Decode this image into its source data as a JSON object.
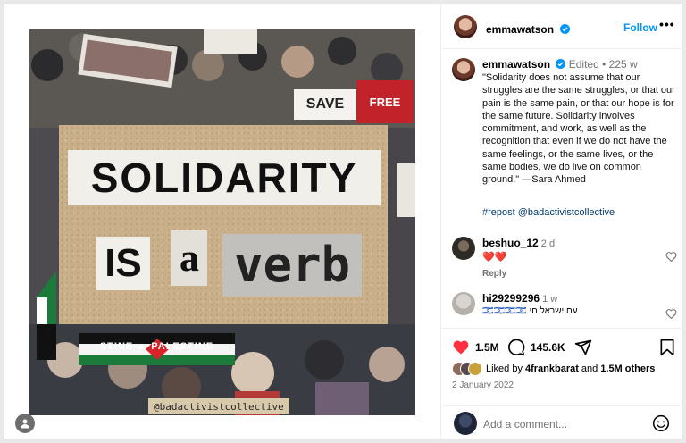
{
  "post": {
    "author": "emmawatson",
    "follow_label": "Follow",
    "more_label": "•••",
    "caption_meta_edited": "Edited",
    "caption_meta_dot": "•",
    "caption_meta_age": "225 w",
    "caption_text": "\"Solidarity does not assume that our struggles are the same struggles, or that our pain is the same pain, or that our hope is for the same future. Solidarity involves commitment, and work, as well as the recognition that even if we do not have the same feelings, or the same lives, or the same bodies, we do live on common ground.\" —Sara Ahmed",
    "caption_tags": "#repost @badactivistcollective"
  },
  "image": {
    "headline_word_1": "SOLIDARITY",
    "headline_word_2": "IS",
    "headline_word_3": "a",
    "headline_word_4": "verb",
    "sign_save": "SAVE",
    "sign_free": "FREE",
    "banner_text": "STINE ▲ PALESTINE",
    "watermark": "@badactivistcollective"
  },
  "comments": [
    {
      "user": "beshuo_12",
      "age": "2 d",
      "text": "❤️❤️",
      "reply_label": "Reply"
    },
    {
      "user": "hi29299296",
      "age": "1 w",
      "text": "🇮🇱🇮🇱🇮🇱🇮🇱 עם ישראל חי"
    }
  ],
  "stats": {
    "likes_count": "1.5M",
    "comments_count": "145.6K",
    "liked_by_prefix": "Liked by",
    "liked_by_user": "4frankbarat",
    "liked_by_and": "and",
    "liked_by_others": "1.5M others",
    "date": "2 January 2022"
  },
  "add_comment": {
    "placeholder": "Add a comment..."
  },
  "icons": {
    "verified": "verified-badge-icon",
    "like": "heart-icon",
    "comment": "comment-bubble-icon",
    "share": "paper-plane-icon",
    "save": "bookmark-icon",
    "emoji": "smiley-icon",
    "user": "user-silhouette-icon"
  },
  "colors": {
    "accent": "#0095f6",
    "like_red": "#ff3040",
    "link_blue": "#00376b",
    "muted": "#737373"
  }
}
